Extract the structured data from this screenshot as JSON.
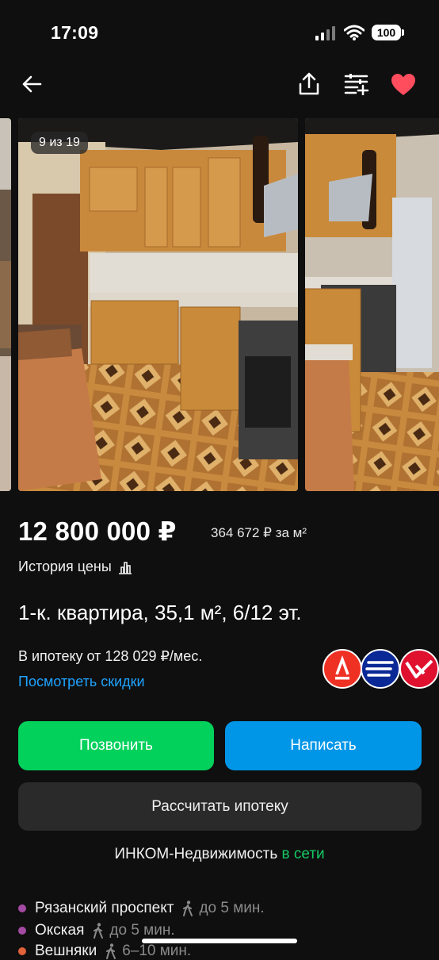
{
  "status_bar": {
    "time": "17:09",
    "battery": "100"
  },
  "nav": {
    "back_icon": "arrow-left-icon",
    "share_icon": "share-icon",
    "compare_icon": "compare-add-icon",
    "favorite_icon": "heart-icon",
    "favorite_color": "#ff4d5e"
  },
  "gallery": {
    "counter": "9 из 19"
  },
  "listing": {
    "price": "12 800 000 ₽",
    "price_per_sqm": "364 672 ₽ за м²",
    "price_history": "История цены",
    "title": "1-к. квартира, 35,1 м², 6/12 эт.",
    "mortgage": "В ипотеку от 128 029 ₽/мес.",
    "discounts": "Посмотреть скидки"
  },
  "actions": {
    "call": "Позвонить",
    "write": "Написать",
    "calc_mortgage": "Рассчитать ипотеку"
  },
  "seller": {
    "name": "ИНКОМ-Недвижимость",
    "status": "в сети"
  },
  "metro": [
    {
      "name": "Рязанский проспект",
      "time": "до 5 мин.",
      "color": "#a34aa3"
    },
    {
      "name": "Окская",
      "time": "до 5 мин.",
      "color": "#a34aa3"
    },
    {
      "name": "Вешняки",
      "time": "6–10 мин.",
      "color": "#e2623a"
    }
  ],
  "colors": {
    "call": "#02d15c",
    "write": "#0096e8",
    "link": "#1fa3ff",
    "online": "#17c964"
  }
}
